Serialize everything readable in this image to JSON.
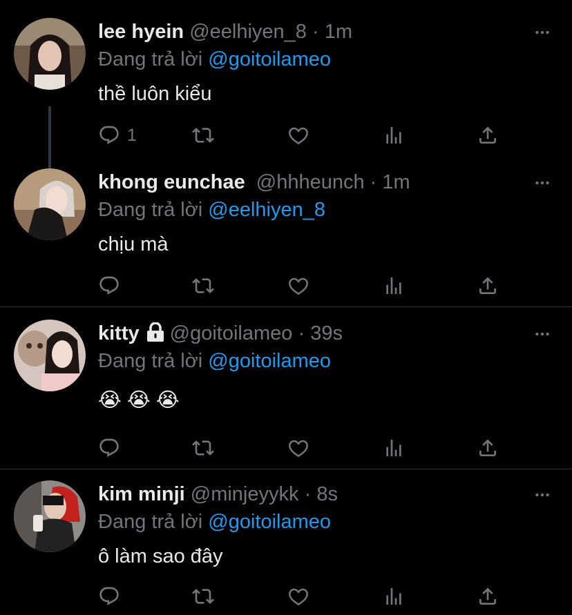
{
  "reply_prefix": "Đang trả lời",
  "tweets": [
    {
      "name": "lee hyein",
      "handle": "@eelhiyen_8",
      "time": "1m",
      "reply_to": "@goitoilameo",
      "text": "thề luôn kiểu",
      "reply_count": "1",
      "locked": false
    },
    {
      "name": "khong eunchae",
      "handle": "@hhheunch",
      "time": "1m",
      "reply_to": "@eelhiyen_8",
      "text": "chịu mà",
      "reply_count": "",
      "locked": false
    },
    {
      "name": "kitty",
      "handle": "@goitoilameo",
      "time": "39s",
      "reply_to": "@goitoilameo",
      "text": "😭 😭 😭",
      "reply_count": "",
      "locked": true
    },
    {
      "name": "kim minji",
      "handle": "@minjeyykk",
      "time": "8s",
      "reply_to": "@goitoilameo",
      "text": "ô làm sao đây",
      "reply_count": "",
      "locked": false
    }
  ],
  "colors": {
    "background": "#000000",
    "text": "#e7e9ea",
    "muted": "#71767b",
    "accent": "#1d9bf0",
    "divider": "#2f3336"
  },
  "icons": {
    "reply": "reply-icon",
    "retweet": "retweet-icon",
    "like": "heart-icon",
    "views": "views-icon",
    "share": "share-icon",
    "more": "more-icon",
    "lock": "lock-icon"
  }
}
